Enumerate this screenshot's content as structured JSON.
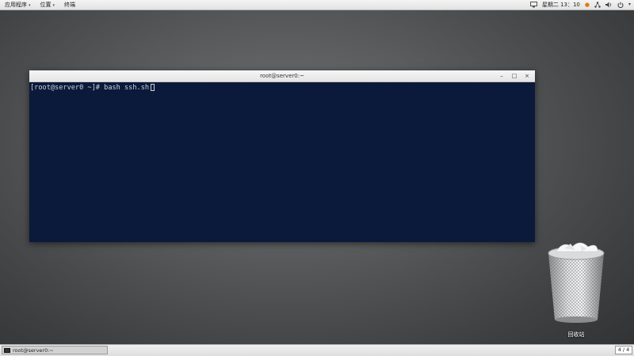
{
  "top_panel": {
    "menu": [
      {
        "label": "应用程序"
      },
      {
        "label": "位置"
      },
      {
        "label": "终端"
      }
    ],
    "clock": "星期二 13：10",
    "icons": [
      "screen-icon",
      "notification-icon",
      "network-icon",
      "volume-icon",
      "power-icon"
    ]
  },
  "window": {
    "title": "root@server0:~",
    "controls": {
      "minimize": "–",
      "maximize": "□",
      "close": "×"
    },
    "terminal": {
      "prompt": "[root@server0 ~]# ",
      "command": "bash ssh.sh"
    }
  },
  "desktop": {
    "trash_label": "回收站"
  },
  "bottom_panel": {
    "task_label": "root@server0:~",
    "workspace": "4 / 4"
  },
  "colors": {
    "terminal_bg": "#0b1a3a",
    "terminal_fg": "#c9d1dc",
    "notification": "#e07a10"
  }
}
